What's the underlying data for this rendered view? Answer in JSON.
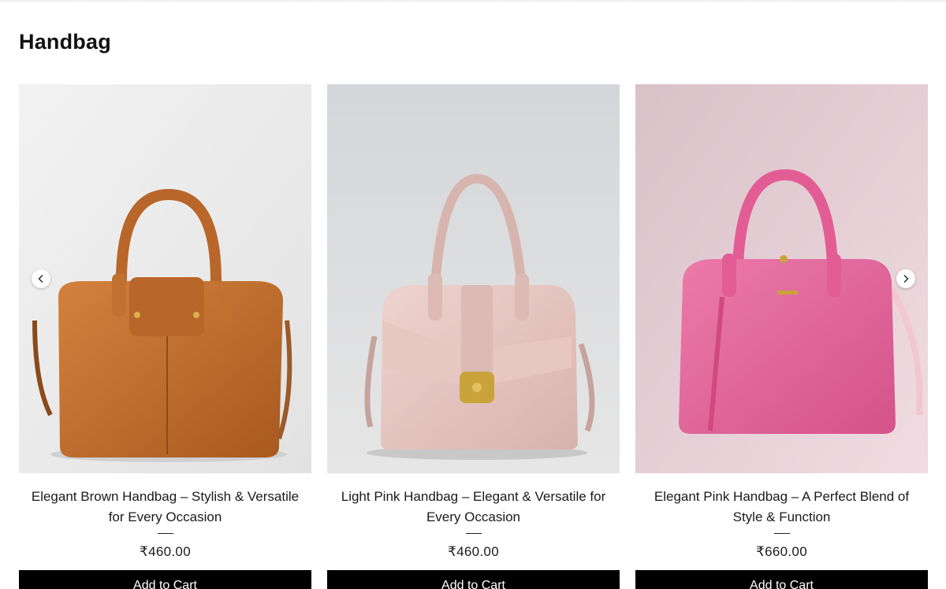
{
  "section": {
    "title": "Handbag"
  },
  "carousel": {
    "prev_icon": "chevron-left-icon",
    "next_icon": "chevron-right-icon"
  },
  "products": [
    {
      "name": "Elegant Brown Handbag – Stylish & Versatile for Every Occasion",
      "price": "₹460.00",
      "button_label": "Add to Cart",
      "image": "brown-handbag-image",
      "colors": {
        "bag": "#c0702f",
        "bg": "#ebebeb"
      }
    },
    {
      "name": "Light Pink Handbag – Elegant & Versatile for Every Occasion",
      "price": "₹460.00",
      "button_label": "Add to Cart",
      "image": "light-pink-handbag-image",
      "colors": {
        "bag": "#e3c3bf",
        "bg": "#dcdcdc"
      }
    },
    {
      "name": "Elegant Pink Handbag – A Perfect Blend of Style & Function",
      "price": "₹660.00",
      "button_label": "Add to Cart",
      "image": "pink-handbag-image",
      "colors": {
        "bag": "#e0669a",
        "bg": "#e8cfd6"
      }
    }
  ]
}
